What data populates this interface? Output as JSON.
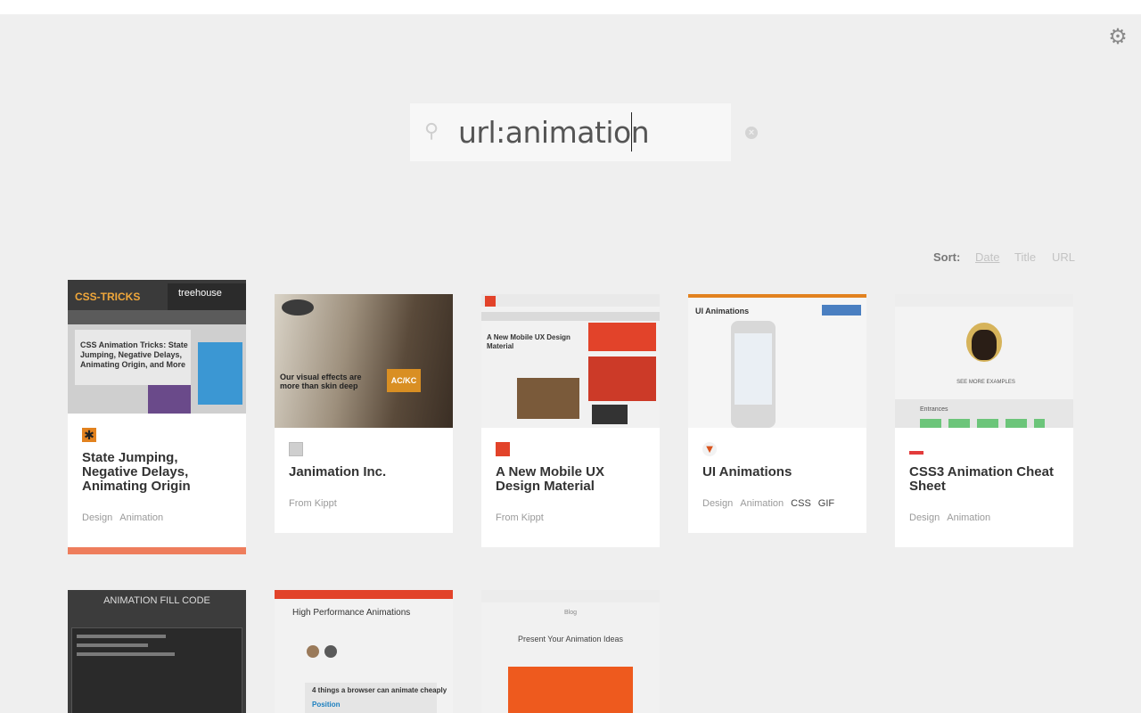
{
  "search": {
    "query": "url:animation",
    "placeholder": ""
  },
  "sort": {
    "label": "Sort:",
    "options": [
      "Date",
      "Title",
      "URL"
    ],
    "active": "Date"
  },
  "icons": {
    "settings": "gear-icon",
    "search": "search-icon",
    "clear": "clear-icon"
  },
  "colors": {
    "background": "#efefef",
    "card": "#ffffff",
    "selected_accent": "#ee7d5c",
    "muted_text": "#9a9a9a"
  },
  "cards": [
    {
      "title": "State Jumping, Negative Delays, Animating Origin",
      "tags": [
        "Design",
        "Animation"
      ],
      "selected": true,
      "thumb": {
        "logo": "CSS-TRICKS",
        "badge": "treehouse",
        "headline": "CSS Animation Tricks: State Jumping, Negative Delays, Animating Origin, and More"
      }
    },
    {
      "title": "Janimation Inc.",
      "source": "From Kippt",
      "thumb": {
        "tagline": "Our visual effects are more than skin deep",
        "badge": "AC/KC"
      }
    },
    {
      "title": "A New Mobile UX Design Material",
      "source": "From Kippt",
      "thumb": {
        "headline": "A New Mobile UX Design Material"
      }
    },
    {
      "title": "UI Animations",
      "tags": [
        "Design",
        "Animation",
        "CSS",
        "GIF"
      ],
      "thumb": {
        "headline": "UI Animations"
      }
    },
    {
      "title": "CSS3 Animation Cheat Sheet",
      "tags": [
        "Design",
        "Animation"
      ],
      "thumb": {
        "link": "SEE MORE EXAMPLES",
        "section": "Entrances"
      }
    },
    {
      "title": "",
      "thumb": {
        "headline": "ANIMATION FILL CODE"
      }
    },
    {
      "title": "",
      "thumb": {
        "headline": "High Performance Animations",
        "sub": "4 things a browser can animate cheaply",
        "row": "Position"
      }
    },
    {
      "title": "",
      "thumb": {
        "section": "Blog",
        "headline": "Present Your Animation Ideas"
      }
    }
  ]
}
